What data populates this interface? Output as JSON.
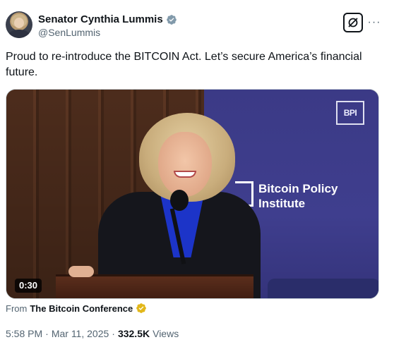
{
  "author": {
    "display_name": "Senator Cynthia Lummis",
    "handle": "@SenLummis",
    "avatar_icon": "senator-avatar",
    "verified_icon": "gray-verified-badge",
    "verified_color": "#829aab"
  },
  "actions": {
    "grok_icon": "grok-icon",
    "more_label": "···"
  },
  "tweet": {
    "text": "Proud to re-introduce the BITCOIN Act. Let’s secure America’s financial future."
  },
  "media": {
    "duration": "0:30",
    "logo_text": "BPI",
    "backdrop_line1": "Bitcoin Policy",
    "backdrop_line2": "Institute",
    "backdrop_color": "#3d3c8c"
  },
  "source": {
    "prefix": "From",
    "name": "The Bitcoin Conference",
    "verified_icon": "gold-verified-badge",
    "verified_color": "#e2b719"
  },
  "meta": {
    "time": "5:58 PM",
    "sep1": "·",
    "date": "Mar 11, 2025",
    "sep2": "·",
    "views_count": "332.5K",
    "views_label": "Views"
  }
}
